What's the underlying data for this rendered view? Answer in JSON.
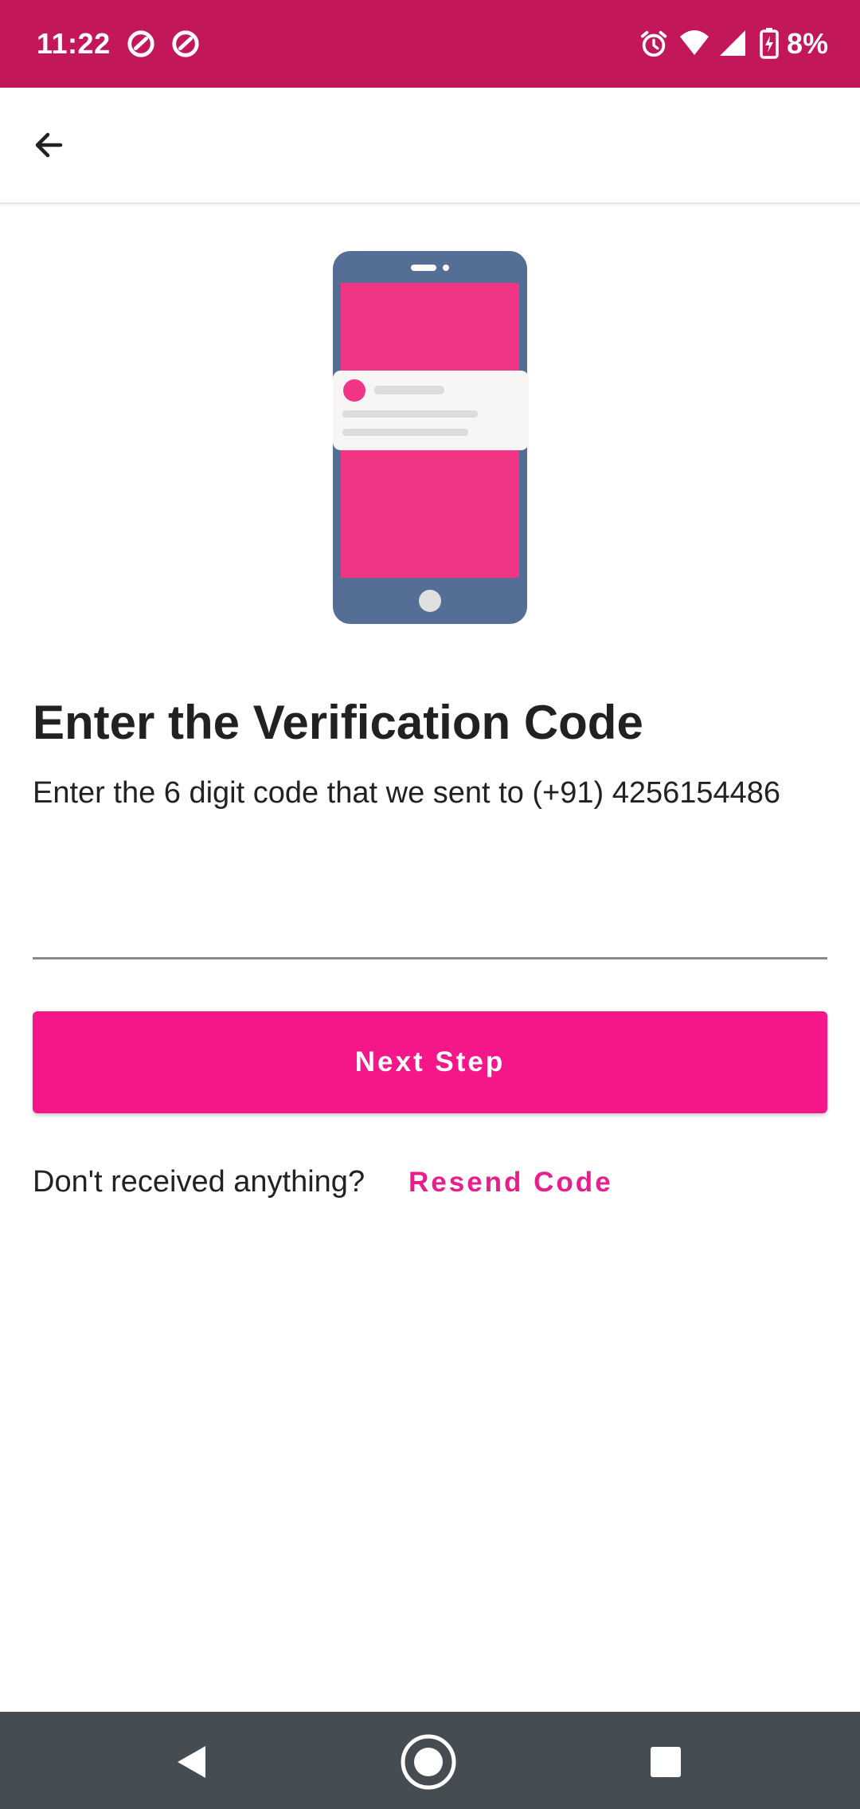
{
  "status_bar": {
    "time": "11:22",
    "battery": "8%",
    "color": "#c2185b",
    "icons": [
      "notification-icon",
      "notification-icon",
      "alarm-icon",
      "wifi-icon",
      "signal-icon",
      "battery-charging-icon"
    ]
  },
  "app_bar": {
    "back_icon": "arrow-back-icon"
  },
  "main": {
    "title": "Enter the Verification Code",
    "subtitle": "Enter the 6 digit code that we sent to (+91) 4256154486",
    "code_input": {
      "value": "",
      "placeholder": ""
    },
    "next_button_label": "Next Step",
    "resend_prompt": "Don't received anything?",
    "resend_link": "Resend Code"
  },
  "nav_bar": {
    "back": "nav-back-icon",
    "home": "nav-home-icon",
    "recents": "nav-recents-icon"
  },
  "colors": {
    "accent": "#f5178a",
    "link": "#e91e8c",
    "phone_body": "#546e96",
    "phone_screen": "#f33585"
  }
}
